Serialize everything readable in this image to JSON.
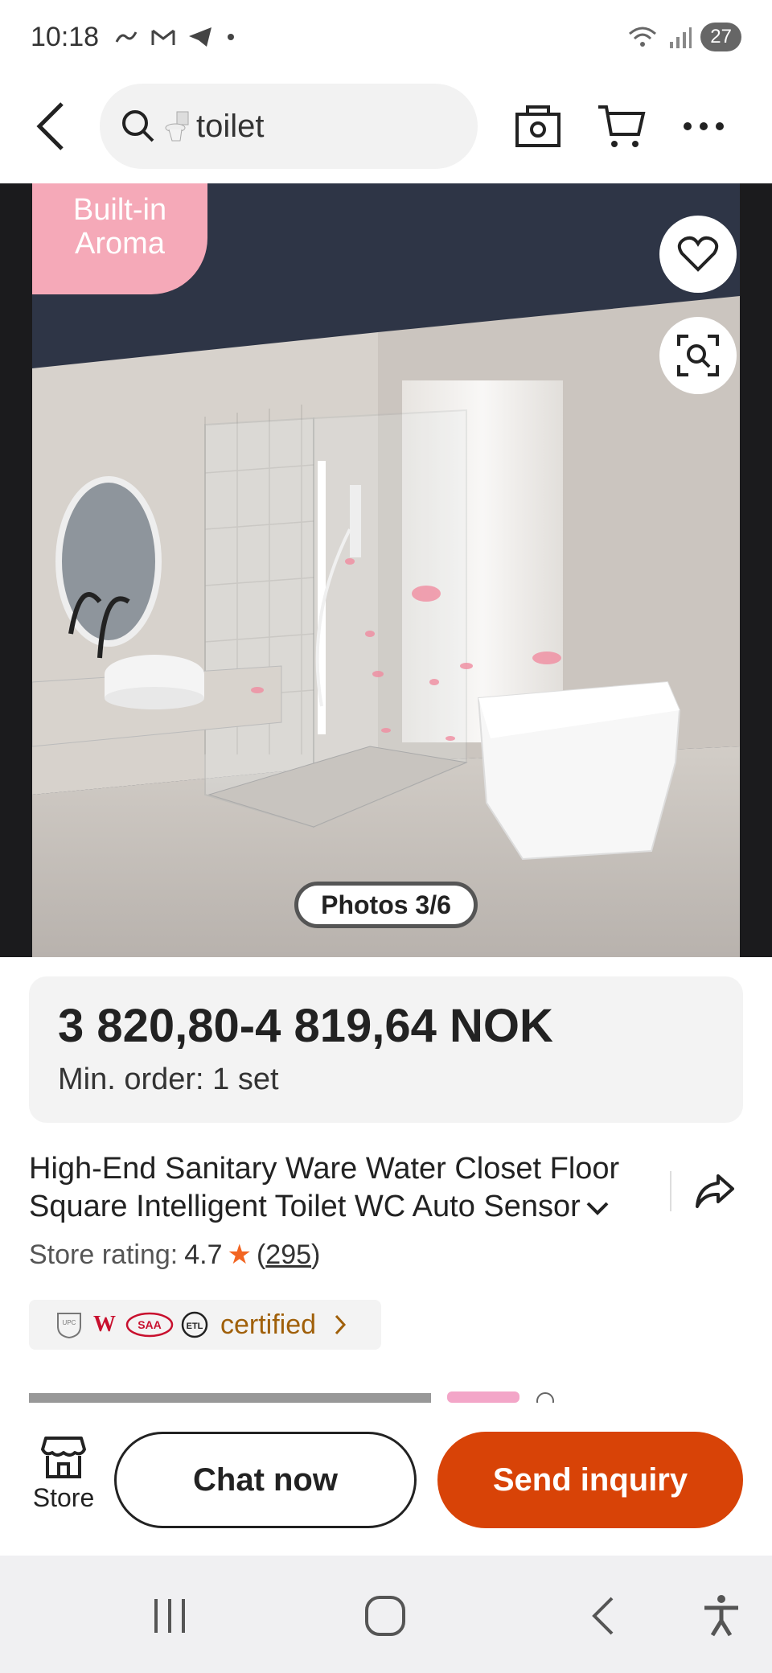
{
  "status_bar": {
    "time": "10:18",
    "battery": "27"
  },
  "search": {
    "query": "toilet"
  },
  "gallery": {
    "badge_line1": "Built-in",
    "badge_line2": "Aroma",
    "photo_counter": "Photos 3/6"
  },
  "price": {
    "range": "3 820,80-4 819,64 NOK",
    "min_order": "Min. order: 1 set"
  },
  "product": {
    "title": "High-End Sanitary Ware Water Closet Floor Square Intelligent Toilet WC Auto Sensor",
    "rating_label": "Store rating:",
    "rating_value": "4.7",
    "rating_count_open": "(",
    "rating_count": "295",
    "rating_count_close": ")"
  },
  "certifications": {
    "label": "certified",
    "logos": [
      "UPC",
      "W",
      "SAA",
      "ETL"
    ]
  },
  "actions": {
    "store_label": "Store",
    "chat_label": "Chat now",
    "inquiry_label": "Send inquiry"
  },
  "colors": {
    "accent": "#d84307",
    "badge_pink": "#f5a9b8",
    "star": "#f26522",
    "cert_text": "#a0600a"
  }
}
